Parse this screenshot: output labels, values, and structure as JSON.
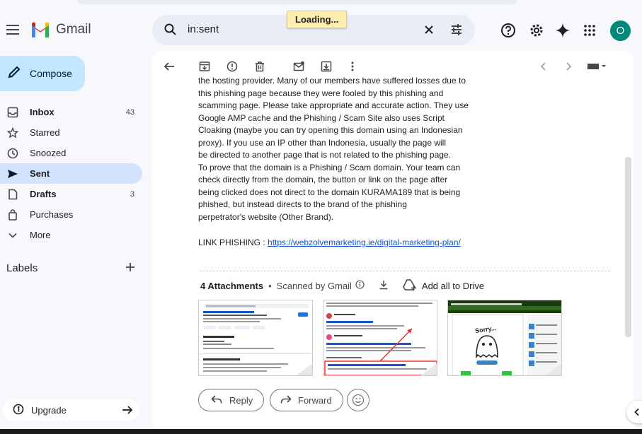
{
  "app": {
    "name": "Gmail",
    "loading": "Loading..."
  },
  "search": {
    "value": "in:sent"
  },
  "account": {
    "avatar_letter": "O"
  },
  "compose": {
    "label": "Compose"
  },
  "sidebar": {
    "items": [
      {
        "label": "Inbox",
        "count": "43",
        "icon": "inbox-icon"
      },
      {
        "label": "Starred",
        "count": "",
        "icon": "star-icon"
      },
      {
        "label": "Snoozed",
        "count": "",
        "icon": "clock-icon"
      },
      {
        "label": "Sent",
        "count": "",
        "icon": "send-icon"
      },
      {
        "label": "Drafts",
        "count": "3",
        "icon": "draft-icon"
      },
      {
        "label": "Purchases",
        "count": "",
        "icon": "bag-icon"
      },
      {
        "label": "More",
        "count": "",
        "icon": "chevron-down-icon"
      }
    ],
    "labels_heading": "Labels",
    "upgrade": "Upgrade"
  },
  "message": {
    "lines": [
      "the hosting provider. Many of our members have suffered losses due to",
      "this phishing page because they were fooled by this phishing and",
      "scamming page. Please take appropriate and accurate action. They use",
      "Google AMP cache and the Phishing / Scam Site also uses Script",
      "Cloaking (maybe you can try opening this domain using an Indonesian",
      "proxy). If you use an IP other than Indonesia, usually the page will",
      "be directed to another page that is not related to the phishing page.",
      "To prove that the domain is a Phishing / Scam domain. Your team can",
      "check directly from the domain, the button or link on the page after",
      "being clicked does not direct to the domain KURAMA189 that is being",
      "phished, but instead directs to the brand of the phishing",
      "perpetrator's website (Other Brand)."
    ],
    "link_label": "LINK PHISHING : ",
    "link_url": "https://webzolvemarketing.ie/digital-marketing-plan/"
  },
  "attachments": {
    "title": "4 Attachments",
    "separator": "•",
    "scanned": "Scanned by Gmail",
    "add_drive": "Add all to Drive",
    "thumb_texts": [
      "SURGA711 | Platform slot Mahjong Gampang Menang Saat Ini",
      "Terhubung dengan kurama189 @kurama189 March 19, 2025",
      "SURGA711 | Platform slot Mahjong Gampang Menang Saat Ini"
    ],
    "sorry_text": "Sorry..."
  },
  "actions": {
    "reply": "Reply",
    "forward": "Forward"
  }
}
